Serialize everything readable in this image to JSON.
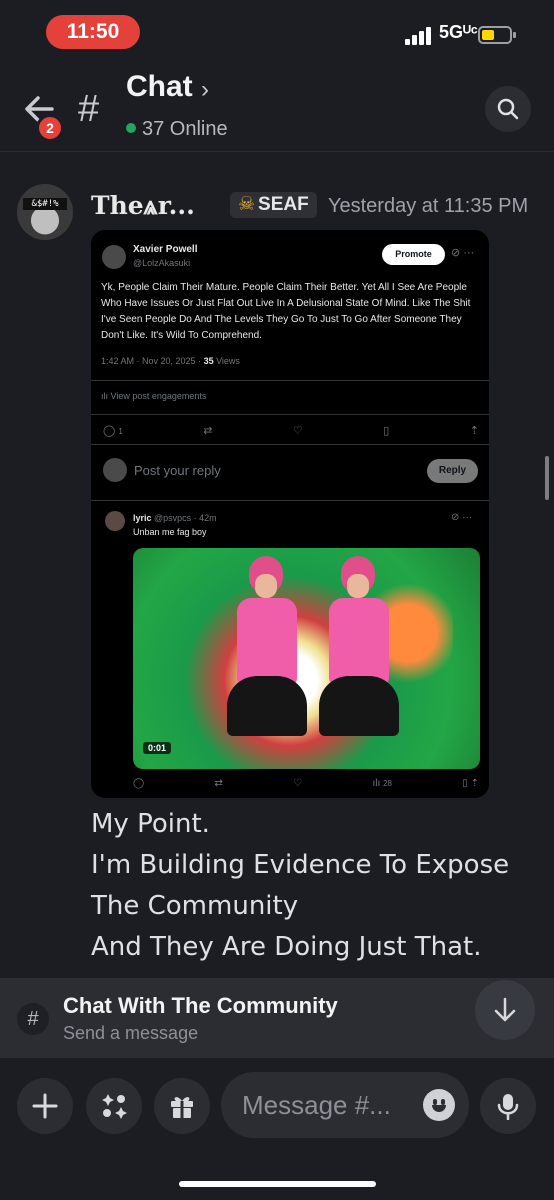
{
  "status_bar": {
    "time": "11:50",
    "network": "5Gᵁᶜ",
    "battery_percent": 35
  },
  "header": {
    "back_badge": "2",
    "title": "Chat",
    "chevron": "›",
    "online": "37 Online"
  },
  "message": {
    "author": "The⩓r...",
    "tag_icon": "skull-icon",
    "tag": "SEAF",
    "timestamp": "Yesterday at 11:35 PM",
    "avatar_text": "&$#!%",
    "lines": [
      "My Point.",
      "I'm Building Evidence To Expose",
      "The Community",
      "And They Are Doing Just That."
    ]
  },
  "embed": {
    "name": "Xavier Powell",
    "handle": "@LolzAkasuki",
    "promote": "Promote",
    "text": "Yk, People Claim Their Mature. People Claim Their Better. Yet All I See Are People Who Have Issues Or Just Flat Out Live In A Delusional State Of Mind. Like The Shit I've Seen People Do And The Levels They Go To Just To Go After Someone They Don't Like. It's Wild To Comprehend.",
    "meta_date": "1:42 AM · Nov 20, 2025 · ",
    "meta_views_count": "35",
    "meta_views_label": " Views",
    "engagements": "View post engagements",
    "reply_count": "1",
    "reply_placeholder": "Post your reply",
    "reply_button": "Reply",
    "reply_tweet": {
      "name": "lyric",
      "handle": "@psvpcs · 42m",
      "text": "Unban me fag boy",
      "video_time": "0:01",
      "views": "28"
    }
  },
  "banner": {
    "title": "Chat With The Community",
    "subtitle": "Send a message"
  },
  "composer": {
    "placeholder": "Message #..."
  },
  "colors": {
    "background": "#1c1d22",
    "badge": "#e5413b",
    "online": "#23a55a",
    "tag_skull": "#f0b232"
  }
}
